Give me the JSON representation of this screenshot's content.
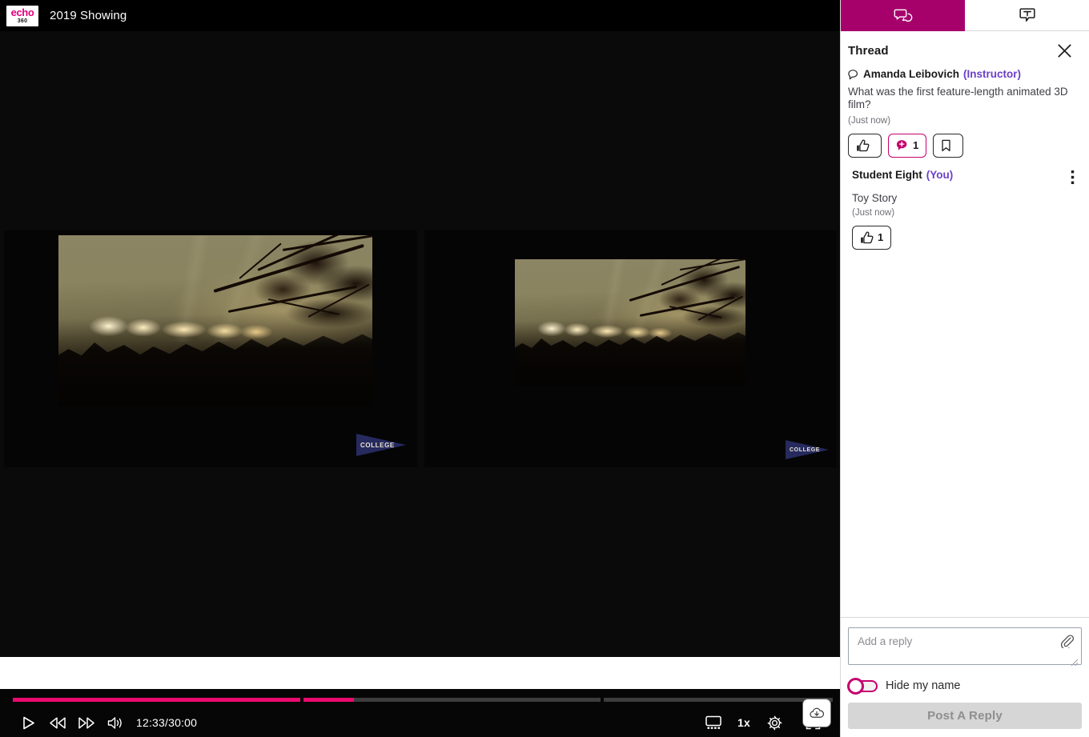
{
  "header": {
    "logo_primary": "echo",
    "logo_secondary": "360",
    "course_title": "2019 Showing"
  },
  "player": {
    "current_time": "12:33",
    "total_time": "30:00",
    "time_display": "12:33/30:00",
    "speed": "1x",
    "controls": {
      "play": "play-button",
      "rewind": "rewind-button",
      "forward": "forward-button",
      "volume": "volume-button",
      "layout": "layout-button",
      "settings": "settings-button",
      "fullscreen": "fullscreen-button",
      "download": "download-button"
    },
    "progress_segments": [
      {
        "width_pct": 35.2,
        "fill_pct": 100
      },
      {
        "width_pct": 36.3,
        "fill_pct": 17
      },
      {
        "width_pct": 28.0,
        "fill_pct": 0
      }
    ],
    "watermark": "COLLEGE",
    "accent_color": "#EB0A6E"
  },
  "panel": {
    "tabs": [
      {
        "id": "discussions",
        "icon": "discussion-bubbles-icon",
        "active": true
      },
      {
        "id": "transcript",
        "icon": "transcript-bubble-icon",
        "active": false
      }
    ],
    "thread_title": "Thread",
    "close_label": "close-icon",
    "post": {
      "author": "Amanda Leibovich",
      "role": "(Instructor)",
      "text": "What was the first feature-length animated 3D film?",
      "time": "(Just now)",
      "actions": {
        "like": "",
        "replies_count": "1",
        "bookmark": ""
      }
    },
    "reply": {
      "author": "Student Eight",
      "role": "(You)",
      "text": "Toy Story",
      "time": "(Just now)",
      "like_count": "1"
    },
    "composer": {
      "placeholder": "Add a reply",
      "value": "",
      "attach_label": "attach-icon",
      "hide_name_label": "Hide my name",
      "hide_name_on": false,
      "submit_label": "Post A Reply",
      "submit_disabled": true
    },
    "accent_color": "#A6006B",
    "role_color": "#6B3FC9"
  }
}
